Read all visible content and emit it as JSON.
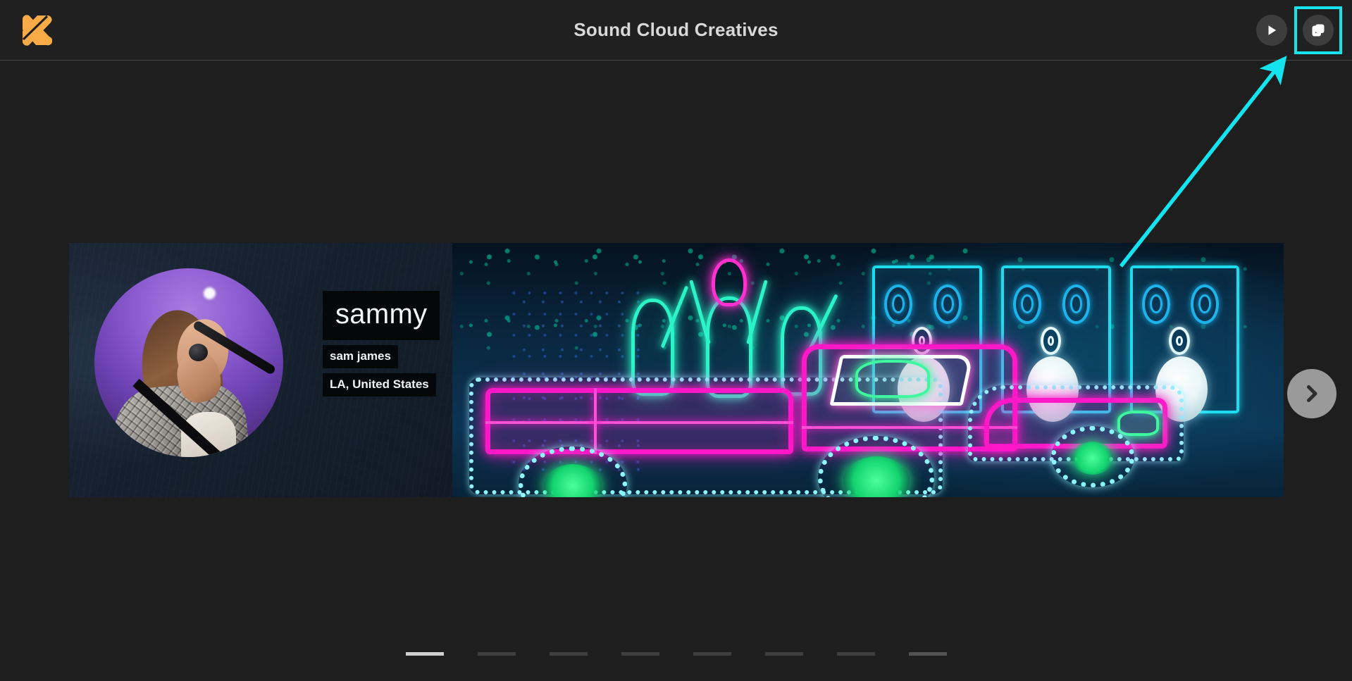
{
  "header": {
    "logo_icon": "slanted-bars-logo-icon",
    "title": "Sound Cloud Creatives",
    "actions": [
      {
        "id": "preview",
        "icon": "play-icon",
        "label": "Preview"
      },
      {
        "id": "duplicate",
        "icon": "copy-icon",
        "label": "Duplicate"
      }
    ]
  },
  "theme": {
    "app_background": "#1e1e1e",
    "header_background": "#202020",
    "title_color": "#d8d8d8",
    "logo_color": "#f9ab48",
    "accent_highlight": "#14e3f0",
    "button_circle": "#3d3d3d",
    "arrow_circle": "#9a9a9a",
    "pagination_active": "#d0d0d0",
    "pagination_inactive": "#3f3f3f"
  },
  "slide": {
    "artist": {
      "name": "sammy",
      "real_name": "sam james",
      "location": "LA, United States",
      "avatar_alt": "singer-with-microphone-photo"
    },
    "banner_alt": "neon-art-installation-car-dancers-speakers"
  },
  "navigation": {
    "next_icon": "chevron-right-icon",
    "next_label": "Next",
    "pagination": {
      "total": 8,
      "active_index": 0
    }
  },
  "annotation": {
    "target": "duplicate",
    "arrow_color": "#14e3f0",
    "box_color": "#14e3f0"
  }
}
